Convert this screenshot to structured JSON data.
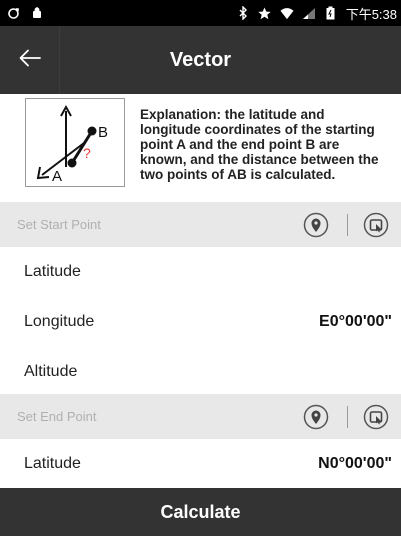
{
  "status_bar": {
    "time": "下午5:38",
    "icons": [
      "sync-icon",
      "android-icon",
      "bluetooth-icon",
      "star-icon",
      "wifi-icon",
      "signal-icon",
      "battery-icon"
    ]
  },
  "app_bar": {
    "title": "Vector",
    "back_icon": "arrow-left-icon"
  },
  "explanation": {
    "diagram_label_a": "A",
    "diagram_label_b": "B",
    "diagram_label_q": "?",
    "line1": "Explanation: the latitude and",
    "line2": "longitude coordinates of the starting",
    "line3": "point A and the end point B are",
    "line4": "known, and the distance between the",
    "line5": "two points of AB is calculated."
  },
  "start_section": {
    "label": "Set Start Point",
    "icons": [
      "location-pin-icon",
      "map-select-icon"
    ]
  },
  "start_fields": {
    "latitude_label": "Latitude",
    "latitude_value": "",
    "longitude_label": "Longitude",
    "longitude_value": "E0°00'00\"",
    "altitude_label": "Altitude",
    "altitude_value": ""
  },
  "end_section": {
    "label": "Set End Point",
    "icons": [
      "location-pin-icon",
      "map-select-icon"
    ]
  },
  "end_fields": {
    "latitude_label": "Latitude",
    "latitude_value": "N0°00'00\""
  },
  "calculate": {
    "label": "Calculate"
  },
  "colors": {
    "app_bar": "#333333",
    "section_header": "#e8e8e8",
    "diagram_red": "#e53935"
  }
}
